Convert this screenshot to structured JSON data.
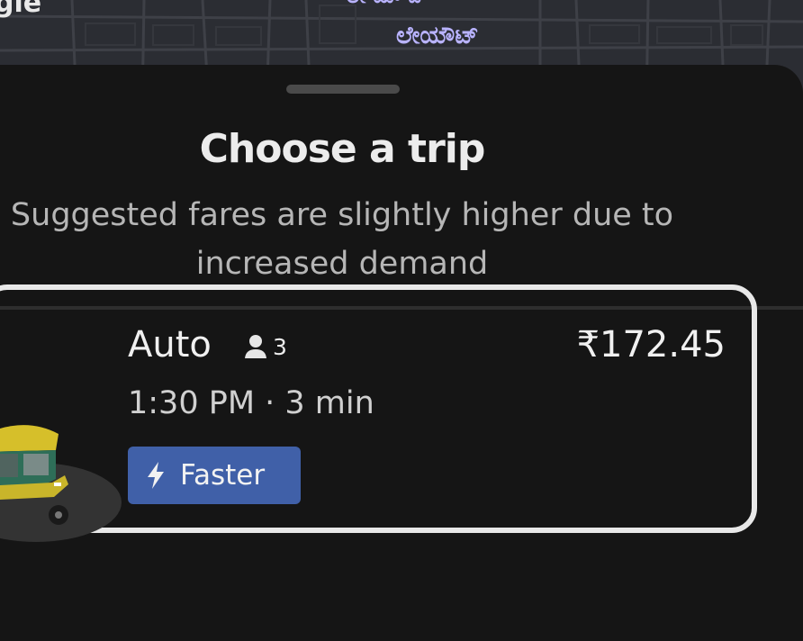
{
  "map": {
    "logo_text": "gle",
    "place_label_top": "ಲೇ ಯೌ ಟ್",
    "place_label": "ಲೇಯೌಟ್"
  },
  "sheet": {
    "title": "Choose a trip",
    "subtitle_line1": "Suggested fares are slightly higher due to",
    "subtitle_line2": "increased demand"
  },
  "option": {
    "name": "Auto",
    "capacity": "3",
    "price": "₹172.45",
    "eta": "1:30 PM · 3 min",
    "badge": {
      "label": "Faster",
      "icon": "lightning-icon",
      "color": "#4060a8"
    },
    "selected": true
  },
  "colors": {
    "background": "#151515",
    "map": "#2b2d33",
    "label_accent": "#b9b3ff"
  }
}
